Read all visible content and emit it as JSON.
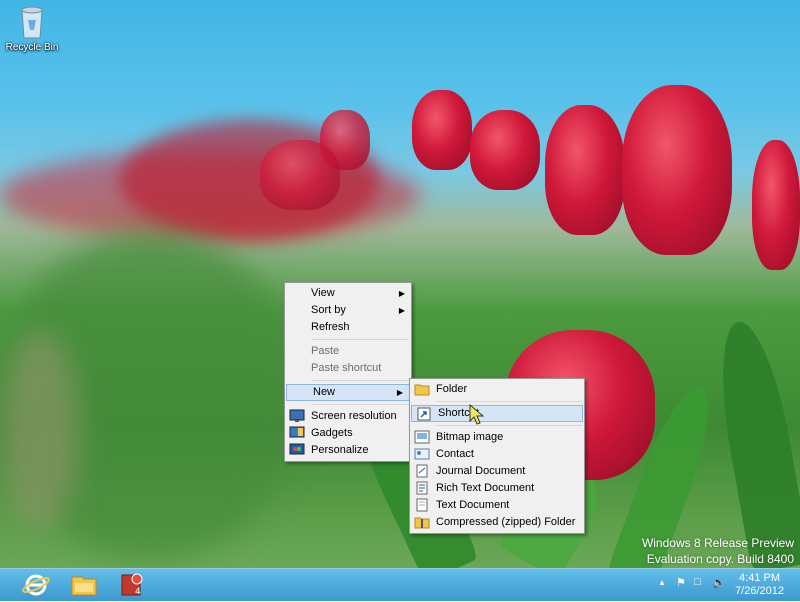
{
  "desktop": {
    "recycle_bin_label": "Recycle Bin",
    "watermark_line1": "Windows 8 Release Preview",
    "watermark_line2": "Evaluation copy. Build 8400"
  },
  "context_menu": {
    "view": "View",
    "sort_by": "Sort by",
    "refresh": "Refresh",
    "paste": "Paste",
    "paste_shortcut": "Paste shortcut",
    "new": "New",
    "screen_resolution": "Screen resolution",
    "gadgets": "Gadgets",
    "personalize": "Personalize"
  },
  "submenu_new": {
    "folder": "Folder",
    "shortcut": "Shortcut",
    "bitmap_image": "Bitmap image",
    "contact": "Contact",
    "journal_document": "Journal Document",
    "rich_text_document": "Rich Text Document",
    "text_document": "Text Document",
    "compressed_folder": "Compressed (zipped) Folder"
  },
  "taskbar": {
    "time": "4:41 PM",
    "date": "7/26/2012",
    "pinned": [
      "internet-explorer-icon",
      "file-explorer-icon",
      "media-center-icon"
    ]
  },
  "colors": {
    "taskbar": "#3a9ad6",
    "menu_bg": "#f0f0f0",
    "highlight": "#d5e5f5"
  }
}
